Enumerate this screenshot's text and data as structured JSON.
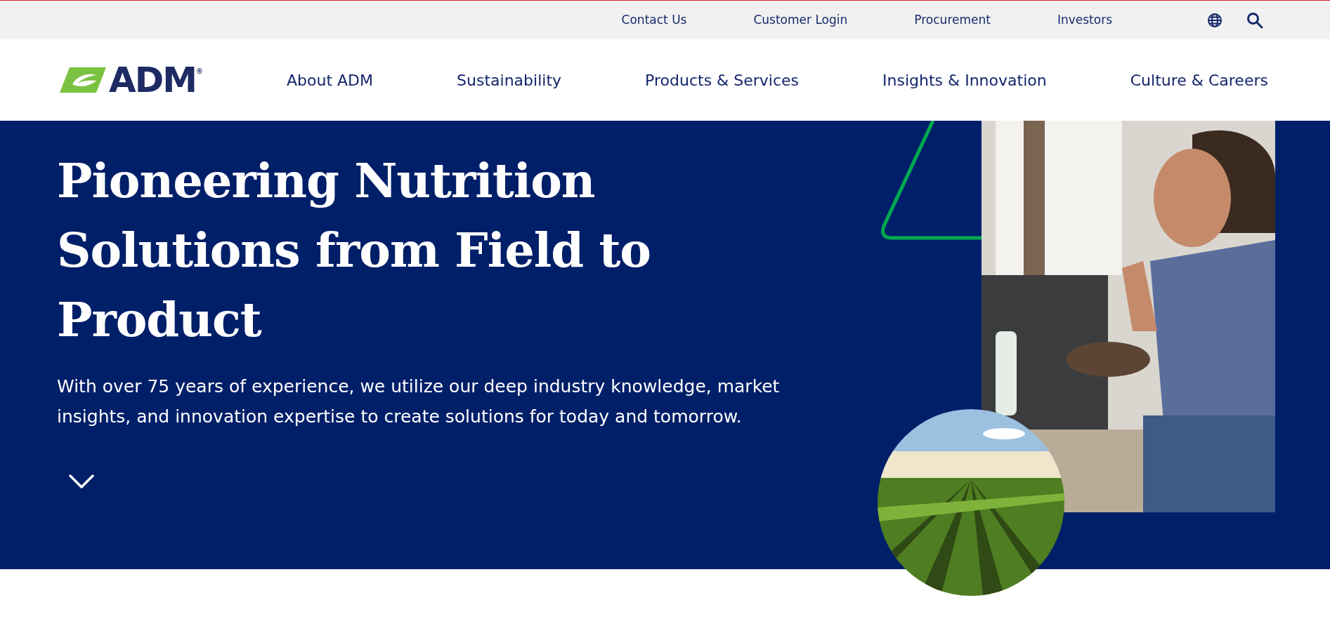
{
  "utility_bar": {
    "links": [
      {
        "label": "Contact Us"
      },
      {
        "label": "Customer Login"
      },
      {
        "label": "Procurement"
      },
      {
        "label": "Investors"
      }
    ]
  },
  "logo": {
    "text": "ADM$^{®}$"
  },
  "main_nav": [
    {
      "label": "About ADM"
    },
    {
      "label": "Sustainability"
    },
    {
      "label": "Products & Services"
    },
    {
      "label": "Insights & Innovation"
    },
    {
      "label": "Culture & Careers"
    }
  ],
  "hero": {
    "title": "Pioneering Nutrition Solutions from Field to Product",
    "text": "With over 75 years of experience, we utilize our deep industry knowledge, market insights, and innovation expertise to create solutions for today and tomorrow."
  }
}
